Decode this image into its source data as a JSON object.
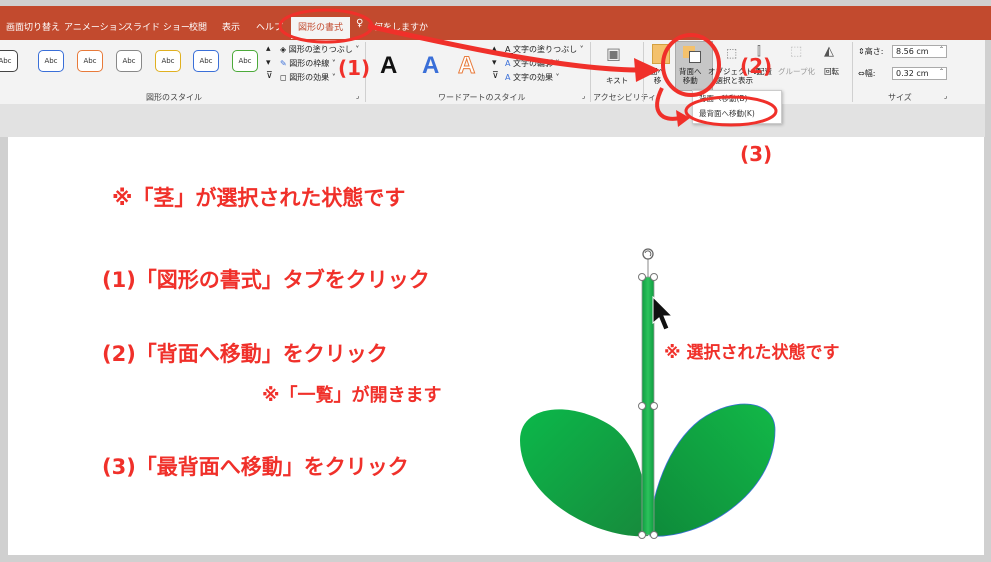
{
  "tabs": [
    {
      "label": "画面切り替え"
    },
    {
      "label": "アニメーション"
    },
    {
      "label": "スライド ショー"
    },
    {
      "label": "校閲"
    },
    {
      "label": "表示"
    },
    {
      "label": "ヘルプ"
    },
    {
      "label": "図形の書式"
    },
    {
      "label": "何をしますか"
    }
  ],
  "ribbon": {
    "shape_styles_label": "図形のスタイル",
    "abc_label": "Abc",
    "abc_colors": [
      "#444444",
      "#3a6fd8",
      "#e87a3a",
      "#888888",
      "#e0b020",
      "#3a6fd8",
      "#4caa3a"
    ],
    "fill_label": "図形の塗りつぶし",
    "outline_label": "図形の枠線",
    "effects_label": "図形の効果",
    "wordart_label": "ワードアートのスタイル",
    "wordart_glyph": "A",
    "text_fill_label": "文字の塗りつぶし",
    "text_outline_label": "文字の輪郭",
    "text_effects_label": "文字の効果",
    "accessibility_label": "アクセシビリティ",
    "alt_text_label": "キスト",
    "bring_forward_label": "面へ\n移",
    "send_backward_label": "背面へ\n移動",
    "selection_pane_label": "オブジェクトの\n選択と表示",
    "align_label": "配置",
    "group_label": "グループ化",
    "rotate_label": "回転",
    "height_label": "高さ:",
    "height_value": "8.56 cm",
    "width_label": "幅:",
    "width_value": "0.32 cm",
    "size_label": "サイズ"
  },
  "dropdown": {
    "item1": "背面へ移動(B)",
    "item2": "最背面へ移動(K)"
  },
  "annotations": {
    "step1_marker": "(1)",
    "step2_marker": "(2)",
    "step3_marker": "(3)",
    "note_selected": "※「茎」が選択された状態です",
    "instr1": "(1)「図形の書式」タブをクリック",
    "instr2": "(2)「背面へ移動」をクリック",
    "note_list": "※「一覧」が開きます",
    "instr3": "(3)「最背面へ移動」をクリック",
    "note_state": "※ 選択された状態です"
  },
  "colors": {
    "accent_red": "#f0302a",
    "ribbon_red": "#c24a2e",
    "leaf_green": "#12a040",
    "stem_green": "#1aa84a"
  }
}
